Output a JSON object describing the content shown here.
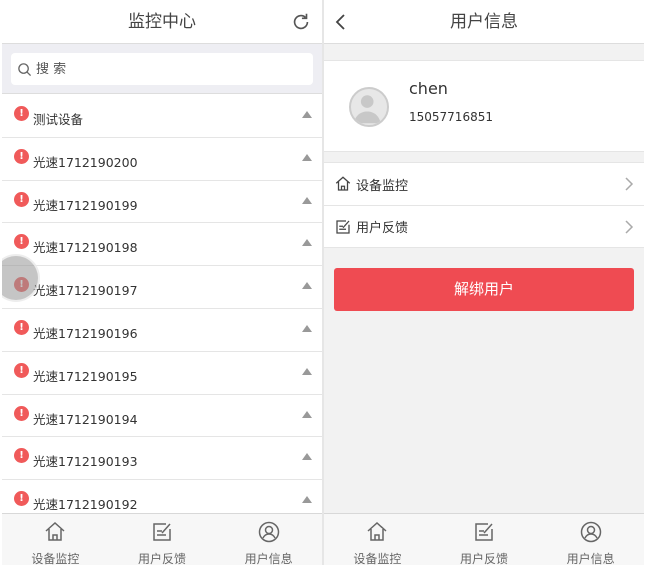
{
  "left": {
    "title": "监控中心",
    "search": {
      "placeholder": "搜 索",
      "value": ""
    },
    "devices": [
      "测试设备",
      "光速1712190200",
      "光速1712190199",
      "光速1712190198",
      "光速1712190197",
      "光速1712190196",
      "光速1712190195",
      "光速1712190194",
      "光速1712190193",
      "光速1712190192"
    ],
    "alert_symbol": "!",
    "tabs": [
      "设备监控",
      "用户反馈",
      "用户信息"
    ]
  },
  "right": {
    "title": "用户信息",
    "user": {
      "name": "chen",
      "phone": "15057716851"
    },
    "menu": [
      "设备监控",
      "用户反馈"
    ],
    "unbind_label": "解绑用户",
    "tabs": [
      "设备监控",
      "用户反馈",
      "用户信息"
    ]
  },
  "colors": {
    "alert": "#f05a5a",
    "button": "#ef4b52"
  },
  "icons": [
    "refresh-icon",
    "back-icon",
    "search-icon",
    "home-icon",
    "feedback-icon",
    "user-icon",
    "chevron-right-icon",
    "caret-up-icon"
  ]
}
